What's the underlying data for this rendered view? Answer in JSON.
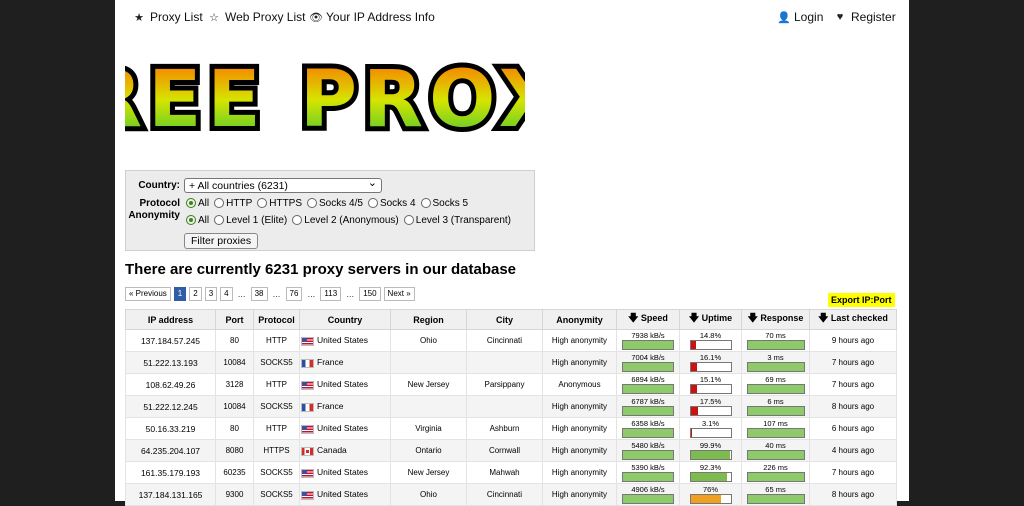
{
  "nav": {
    "proxy_list": "Proxy List",
    "web_proxy_list": "Web Proxy List",
    "ip_info": "Your IP Address Info",
    "login": "Login",
    "register": "Register"
  },
  "logo_text": "FREE PROXY",
  "filter": {
    "country_label": "Country:",
    "country_value": "+ All countries (6231)",
    "protocol_label": "Protocol",
    "protocol_options": [
      "All",
      "HTTP",
      "HTTPS",
      "Socks 4/5",
      "Socks 4",
      "Socks 5"
    ],
    "anonymity_label": "Anonymity",
    "anonymity_options": [
      "All",
      "Level 1 (Elite)",
      "Level 2 (Anonymous)",
      "Level 3 (Transparent)"
    ],
    "button": "Filter proxies"
  },
  "heading": "There are currently 6231 proxy servers in our database",
  "pager": {
    "prev": "« Previous",
    "pages": [
      "1",
      "2",
      "3",
      "4",
      "…",
      "38",
      "…",
      "76",
      "…",
      "113",
      "…",
      "150"
    ],
    "next": "Next »"
  },
  "export": "Export IP:Port",
  "table": {
    "headers": [
      "IP address",
      "Port",
      "Protocol",
      "Country",
      "Region",
      "City",
      "Anonymity",
      "Speed",
      "Uptime",
      "Response",
      "Last checked"
    ],
    "rows": [
      {
        "ip": "137.184.57.245",
        "port": "80",
        "protocol": "HTTP",
        "country": "United States",
        "flag": "us",
        "region": "Ohio",
        "city": "Cincinnati",
        "anonymity": "High anonymity",
        "speed": "7938 kB/s",
        "speed_pct": 100,
        "uptime": "14.8%",
        "uptime_pct": 14.8,
        "uptime_color": "#cc1111",
        "response": "70 ms",
        "response_pct": 100,
        "checked": "9 hours ago"
      },
      {
        "ip": "51.222.13.193",
        "port": "10084",
        "protocol": "SOCKS5",
        "country": "France",
        "flag": "fr",
        "region": "",
        "city": "",
        "anonymity": "High anonymity",
        "speed": "7004 kB/s",
        "speed_pct": 100,
        "uptime": "16.1%",
        "uptime_pct": 16.1,
        "uptime_color": "#cc1111",
        "response": "3 ms",
        "response_pct": 100,
        "checked": "7 hours ago"
      },
      {
        "ip": "108.62.49.26",
        "port": "3128",
        "protocol": "HTTP",
        "country": "United States",
        "flag": "us",
        "region": "New Jersey",
        "city": "Parsippany",
        "anonymity": "Anonymous",
        "speed": "6894 kB/s",
        "speed_pct": 100,
        "uptime": "15.1%",
        "uptime_pct": 15.1,
        "uptime_color": "#cc1111",
        "response": "69 ms",
        "response_pct": 100,
        "checked": "7 hours ago"
      },
      {
        "ip": "51.222.12.245",
        "port": "10084",
        "protocol": "SOCKS5",
        "country": "France",
        "flag": "fr",
        "region": "",
        "city": "",
        "anonymity": "High anonymity",
        "speed": "6787 kB/s",
        "speed_pct": 100,
        "uptime": "17.5%",
        "uptime_pct": 17.5,
        "uptime_color": "#cc1111",
        "response": "6 ms",
        "response_pct": 100,
        "checked": "8 hours ago"
      },
      {
        "ip": "50.16.33.219",
        "port": "80",
        "protocol": "HTTP",
        "country": "United States",
        "flag": "us",
        "region": "Virginia",
        "city": "Ashburn",
        "anonymity": "High anonymity",
        "speed": "6358 kB/s",
        "speed_pct": 100,
        "uptime": "3.1%",
        "uptime_pct": 3.1,
        "uptime_color": "#cc1111",
        "response": "107 ms",
        "response_pct": 100,
        "checked": "6 hours ago"
      },
      {
        "ip": "64.235.204.107",
        "port": "8080",
        "protocol": "HTTPS",
        "country": "Canada",
        "flag": "ca",
        "region": "Ontario",
        "city": "Cornwall",
        "anonymity": "High anonymity",
        "speed": "5480 kB/s",
        "speed_pct": 100,
        "uptime": "99.9%",
        "uptime_pct": 99.9,
        "uptime_color": "#7dbb4e",
        "response": "40 ms",
        "response_pct": 100,
        "checked": "4 hours ago"
      },
      {
        "ip": "161.35.179.193",
        "port": "60235",
        "protocol": "SOCKS5",
        "country": "United States",
        "flag": "us",
        "region": "New Jersey",
        "city": "Mahwah",
        "anonymity": "High anonymity",
        "speed": "5390 kB/s",
        "speed_pct": 100,
        "uptime": "92.3%",
        "uptime_pct": 92.3,
        "uptime_color": "#7dbb4e",
        "response": "226 ms",
        "response_pct": 100,
        "checked": "7 hours ago"
      },
      {
        "ip": "137.184.131.165",
        "port": "9300",
        "protocol": "SOCKS5",
        "country": "United States",
        "flag": "us",
        "region": "Ohio",
        "city": "Cincinnati",
        "anonymity": "High anonymity",
        "speed": "4906 kB/s",
        "speed_pct": 100,
        "uptime": "76%",
        "uptime_pct": 76,
        "uptime_color": "#f0a020",
        "response": "65 ms",
        "response_pct": 100,
        "checked": "8 hours ago"
      }
    ]
  },
  "colors": {
    "bar_green": "#8fca6a",
    "export_bg": "#ffff00",
    "page_active": "#2f5ea8"
  }
}
